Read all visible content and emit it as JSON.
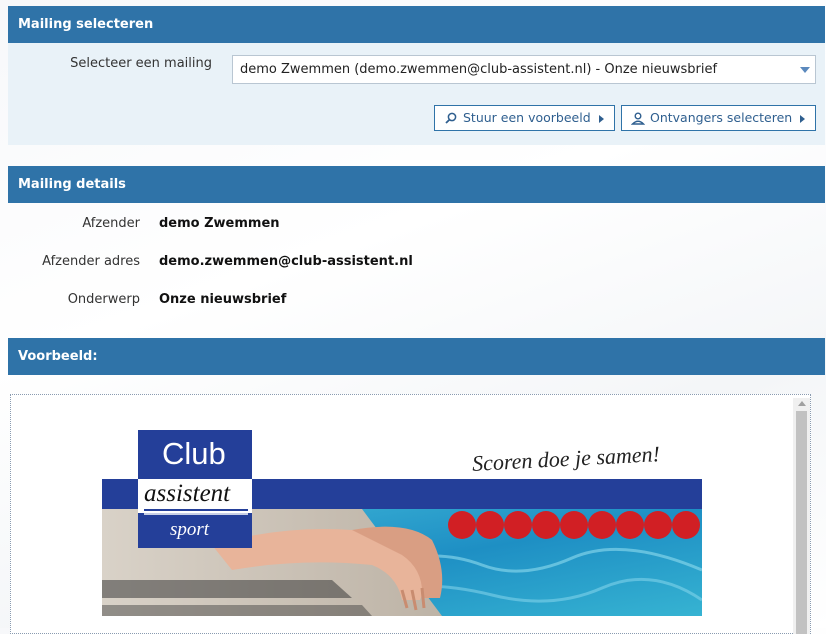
{
  "select_panel": {
    "title": "Mailing selecteren",
    "label": "Selecteer een mailing",
    "selected": "demo Zwemmen (demo.zwemmen@club-assistent.nl) - Onze nieuwsbrief",
    "preview_button": "Stuur een voorbeeld",
    "recipients_button": "Ontvangers selecteren"
  },
  "details_panel": {
    "title": "Mailing details",
    "rows": [
      {
        "label": "Afzender",
        "value": "demo Zwemmen"
      },
      {
        "label": "Afzender adres",
        "value": "demo.zwemmen@club-assistent.nl"
      },
      {
        "label": "Onderwerp",
        "value": "Onze nieuwsbrief"
      }
    ]
  },
  "preview_panel": {
    "title": "Voorbeeld:"
  },
  "banner": {
    "logo_line1": "Club",
    "logo_line2": "assistent",
    "logo_line3": "sport",
    "slogan": "Scoren doe je samen!"
  },
  "colors": {
    "header_blue": "#2f73a8",
    "logo_blue": "#243f99",
    "panel_bg": "#e9f2f8"
  },
  "icons": {
    "preview_button": "search-icon",
    "recipients_button": "user-icon"
  }
}
